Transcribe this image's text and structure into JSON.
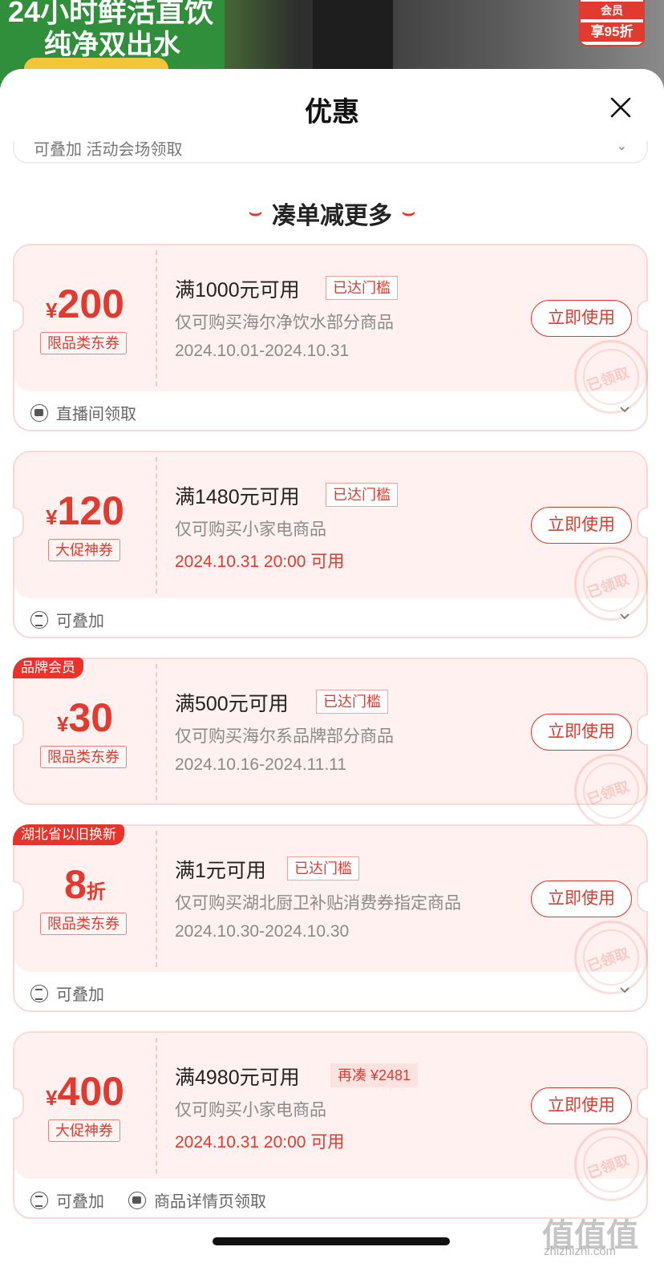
{
  "background": {
    "banner_line1": "24小时鲜活直饮",
    "banner_line2": "纯净双出水",
    "badge_line1": "会员",
    "badge_line2": "享95折"
  },
  "sheet": {
    "title": "优惠",
    "close_icon": "close-icon"
  },
  "partial_coupon": {
    "text": "可叠加    活动会场领取"
  },
  "section": {
    "title": "凑单减更多"
  },
  "coupons": [
    {
      "currency": "¥",
      "amount": "200",
      "unit": "",
      "type": "限品类东券",
      "ribbon": "",
      "condition": "满1000元可用",
      "threshold_tag": "已达门槛",
      "scope": "仅可购买海尔净饮水部分商品",
      "validity": "2024.10.01-2024.10.31",
      "button": "立即使用",
      "stamp": "已领取",
      "foot_tags": [
        "直播间领取"
      ]
    },
    {
      "currency": "¥",
      "amount": "120",
      "unit": "",
      "type": "大促神券",
      "ribbon": "",
      "condition": "满1480元可用",
      "threshold_tag": "已达门槛",
      "scope": "仅可购买小家电商品",
      "validity": "2024.10.31 20:00 可用",
      "button": "立即使用",
      "stamp": "已领取",
      "foot_tags": [
        "可叠加"
      ]
    },
    {
      "currency": "¥",
      "amount": "30",
      "unit": "",
      "type": "限品类东券",
      "ribbon": "品牌会员",
      "condition": "满500元可用",
      "threshold_tag": "已达门槛",
      "scope": "仅可购买海尔系品牌部分商品",
      "validity": "2024.10.16-2024.11.11",
      "button": "立即使用",
      "stamp": "已领取",
      "foot_tags": []
    },
    {
      "currency": "",
      "amount": "8",
      "unit": "折",
      "type": "限品类东券",
      "ribbon": "湖北省以旧换新",
      "condition": "满1元可用",
      "threshold_tag": "已达门槛",
      "scope": "仅可购买湖北厨卫补贴消费券指定商品",
      "validity": "2024.10.30-2024.10.30",
      "button": "立即使用",
      "stamp": "已领取",
      "foot_tags": [
        "可叠加"
      ]
    },
    {
      "currency": "¥",
      "amount": "400",
      "unit": "",
      "type": "大促神券",
      "ribbon": "",
      "condition": "满4980元可用",
      "threshold_tag": "再凑 ¥2481",
      "scope": "仅可购买小家电商品",
      "validity": "2024.10.31 20:00 可用",
      "button": "立即使用",
      "stamp": "已领取",
      "foot_tags": [
        "可叠加",
        "商品详情页领取"
      ]
    }
  ],
  "watermark": {
    "logo": "值值值",
    "site": "zhizhizhi.com"
  },
  "colors": {
    "accent": "#e23a2e",
    "card_bg": "#fff1ef",
    "card_border": "#f7d9d6",
    "text_muted": "#8a8a8a"
  }
}
